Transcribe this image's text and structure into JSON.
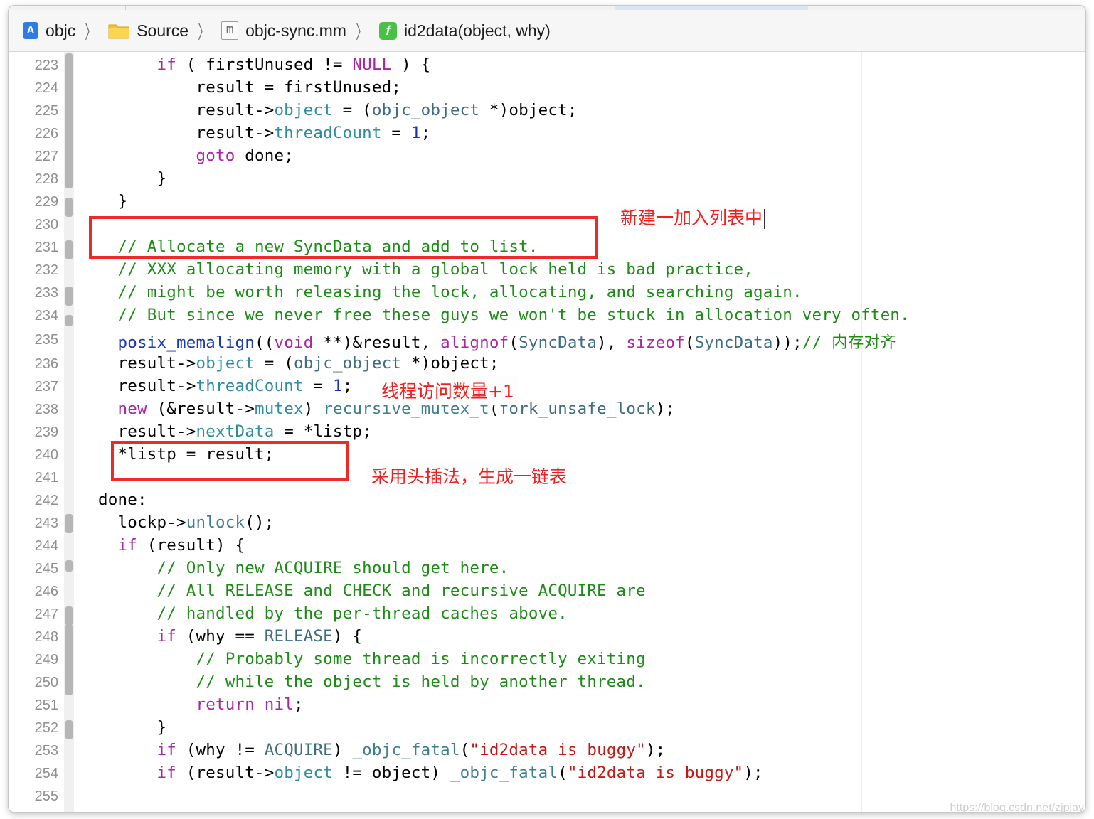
{
  "breadcrumb": {
    "items": [
      {
        "label": "objc",
        "icon": "app-target-icon"
      },
      {
        "label": "Source",
        "icon": "folder-icon"
      },
      {
        "label": "objc-sync.mm",
        "icon": "m-file-icon"
      },
      {
        "label": "id2data(object, why)",
        "icon": "function-icon"
      }
    ]
  },
  "annotations": {
    "note1": "新建一加入列表中",
    "note2": "线程访问数量+1",
    "note3": "采用头插法，生成一链表"
  },
  "watermark": "https://blog.csdn.net/zjpjay",
  "line_numbers": [
    "223",
    "224",
    "225",
    "226",
    "227",
    "228",
    "229",
    "230",
    "231",
    "232",
    "233",
    "234",
    "235",
    "236",
    "237",
    "238",
    "239",
    "240",
    "241",
    "242",
    "243",
    "244",
    "245",
    "246",
    "247",
    "248",
    "249",
    "250",
    "251",
    "252",
    "253",
    "254",
    "255"
  ],
  "colors": {
    "keyword": "#a825a5",
    "comment": "#1d8c17",
    "member": "#2e8da0",
    "number": "#1b2fbf",
    "string": "#c41a16",
    "annotation": "#ef2828"
  }
}
